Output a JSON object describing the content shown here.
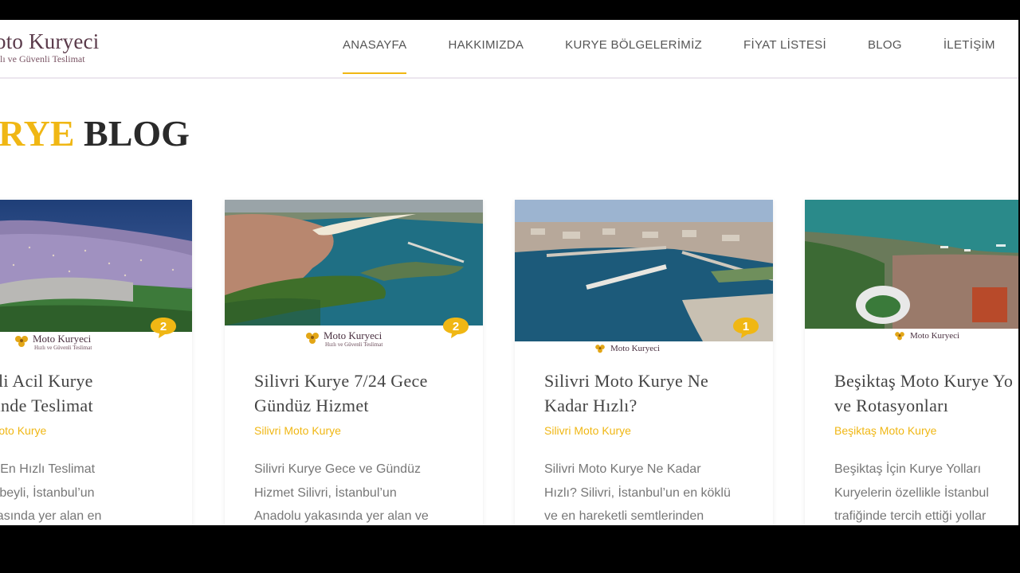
{
  "header": {
    "logo_name": "oto Kuryeci",
    "logo_tagline": "lı ve Güvenli Teslimat",
    "nav": [
      {
        "label": "ANASAYFA",
        "active": true
      },
      {
        "label": "HAKKIMIZDA",
        "active": false
      },
      {
        "label": "KURYE BÖLGELERİMİZ",
        "active": false
      },
      {
        "label": "FİYAT LİSTESİ",
        "active": false
      },
      {
        "label": "BLOG",
        "active": false
      },
      {
        "label": "İLETİŞİM",
        "active": false
      }
    ]
  },
  "page_title": {
    "accent": "RYE",
    "rest": " BLOG"
  },
  "card_logo": {
    "name": "Moto Kuryeci",
    "tagline": "Hızlı ve Güvenli Teslimat"
  },
  "cards": [
    {
      "title_line1": "nbeyli Acil Kurye",
      "title_line2": "k. İçinde Teslimat",
      "category": "beyli Moto Kurye",
      "excerpt": [
        "nbeyli En Hızlı Teslimat",
        "Sultanbeyli, İstanbul’un",
        "lu yakasında yer alan en"
      ],
      "comments": "2"
    },
    {
      "title_line1": "Silivri Kurye 7/24 Gece",
      "title_line2": "Gündüz Hizmet",
      "category": "Silivri Moto Kurye",
      "excerpt": [
        "Silivri Kurye Gece ve Gündüz",
        "Hizmet Silivri, İstanbul’un",
        "Anadolu yakasında yer alan ve"
      ],
      "comments": "2"
    },
    {
      "title_line1": "Silivri Moto Kurye Ne",
      "title_line2": "Kadar Hızlı?",
      "category": "Silivri Moto Kurye",
      "excerpt": [
        "Silivri Moto Kurye Ne Kadar",
        "Hızlı? Silivri, İstanbul’un en köklü",
        "ve en hareketli semtlerinden"
      ],
      "comments": "1"
    },
    {
      "title_line1": "Beşiktaş Moto Kurye Yo",
      "title_line2": "ve Rotasyonları",
      "category": "Beşiktaş Moto Kurye",
      "excerpt": [
        "Beşiktaş İçin Kurye Yolları",
        "Kuryelerin özellikle İstanbul",
        "trafiğinde tercih ettiği yollar"
      ],
      "comments": ""
    }
  ],
  "colors": {
    "accent": "#f0b714",
    "text": "#444444",
    "nav_text": "#555555"
  }
}
